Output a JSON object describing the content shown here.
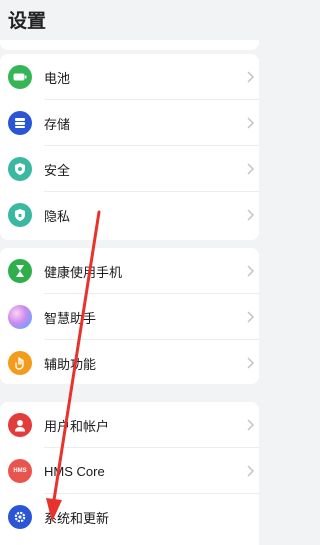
{
  "header": {
    "title": "设置"
  },
  "group1": [
    {
      "label": "电池",
      "icon": "battery-icon",
      "color": "#34b556"
    },
    {
      "label": "存储",
      "icon": "storage-icon",
      "color": "#2a56d6"
    },
    {
      "label": "安全",
      "icon": "security-shield-icon",
      "color": "#3bb8a2"
    },
    {
      "label": "隐私",
      "icon": "privacy-shield-icon",
      "color": "#3bb8a2"
    }
  ],
  "group2": [
    {
      "label": "健康使用手机",
      "icon": "hourglass-icon",
      "color": "#2fae4c"
    },
    {
      "label": "智慧助手",
      "icon": "assistant-orb-icon",
      "color": "#c88bf0"
    },
    {
      "label": "辅助功能",
      "icon": "hand-icon",
      "color": "#f39b1b"
    }
  ],
  "group3": [
    {
      "label": "用户和帐户",
      "icon": "user-icon",
      "color": "#e23d3b"
    },
    {
      "label": "HMS Core",
      "icon": "hms-icon",
      "color": "#e8554e",
      "badge": "HMS"
    },
    {
      "label": "系统和更新",
      "icon": "settings-gear-icon",
      "color": "#2a56d6"
    }
  ]
}
